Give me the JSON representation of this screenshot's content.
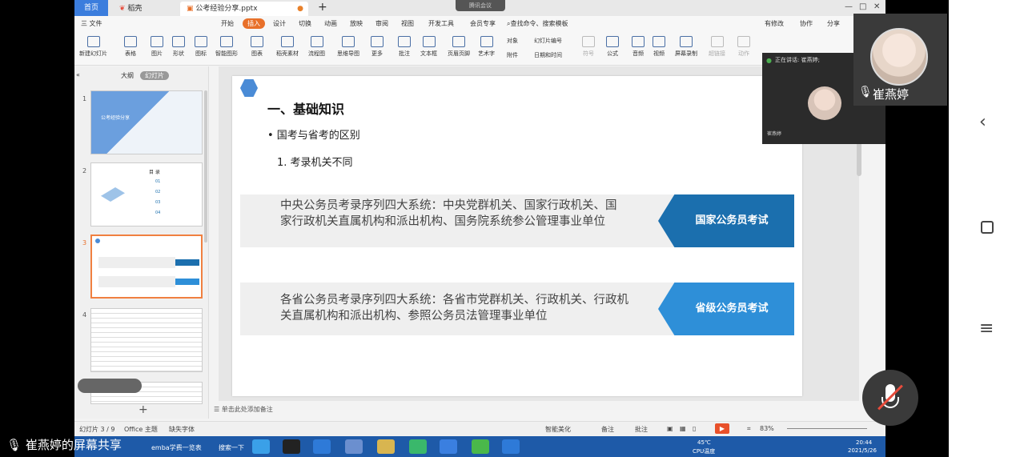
{
  "titlebar": {
    "home_tab": "首页",
    "docer_tab": "稻壳",
    "file_tab": "公考经验分享.pptx",
    "meeting_pill": "腾讯会议",
    "new_tab": "+",
    "win_controls": [
      "—",
      "□",
      "✕"
    ]
  },
  "menu": {
    "file": "三 文件",
    "items": [
      "开始",
      "插入",
      "设计",
      "切换",
      "动画",
      "放映",
      "审阅",
      "视图",
      "开发工具",
      "会员专享"
    ],
    "active_index": 1,
    "search": "查找命令、搜索模板",
    "right": [
      "有修改",
      "协作",
      "分享"
    ]
  },
  "ribbon": {
    "items": [
      "新建幻灯片",
      "表格",
      "图片",
      "形状",
      "图标",
      "智能图形",
      "图表",
      "稻壳素材",
      "流程图",
      "思维导图",
      "更多",
      "批注",
      "文本框",
      "页眉页脚",
      "艺术字",
      "对象",
      "幻灯片编号",
      "附件",
      "日期和时间",
      "符号",
      "公式",
      "音频",
      "视频",
      "屏幕录制",
      "超链接",
      "动作"
    ]
  },
  "leftpane": {
    "tab_outline": "大纲",
    "tab_slides": "幻灯片",
    "thumb1_title": "公考经验分享",
    "thumb2_title": "目 录",
    "thumb2_items": [
      "01",
      "02",
      "03",
      "04"
    ],
    "numbers": [
      "1",
      "2",
      "3",
      "4"
    ],
    "add": "+"
  },
  "slide": {
    "title": "一、基础知识",
    "bullet": "• 国考与省考的区别",
    "sub": "1. 考录机关不同",
    "box1_text": "中央公务员考录序列四大系统：中央党群机关、国家行政机关、国家行政机关直属机构和派出机构、国务院系统参公管理事业单位",
    "box1_tag": "国家公务员考试",
    "box2_text": "各省公务员考录序列四大系统：各省市党群机关、行政机关、行政机关直属机构和派出机构、参照公务员法管理事业单位",
    "box2_tag": "省级公务员考试"
  },
  "notes": "单击此处添加备注",
  "status": {
    "slide_info": "幻灯片 3 / 9",
    "theme": "Office 主题",
    "font": "缺失字体",
    "beautify": "智能美化",
    "notes": "备注",
    "comments": "批注",
    "zoom": "83%"
  },
  "taskbar": {
    "search": "搜索一下",
    "window": "emba学费一览表",
    "temp": "45℃",
    "cpu": "CPU温度",
    "time": "20:44",
    "date": "2021/5/26"
  },
  "call": {
    "speaking": "正在讲话: 崔燕婷;",
    "small_name": "崔燕婷",
    "tile_name": "崔燕婷"
  },
  "share_caption": "崔燕婷的屏幕共享",
  "colors": {
    "accent": "#e8702a",
    "tag_dark": "#1b6fae",
    "tag_light": "#2e8fd8",
    "taskbar": "#1e5aa8"
  }
}
